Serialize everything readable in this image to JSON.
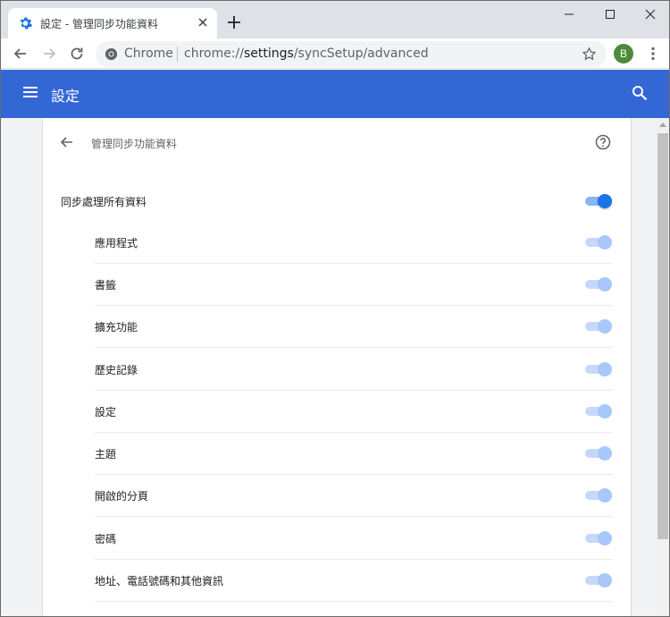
{
  "browser": {
    "tab_title": "設定 - 管理同步功能資料",
    "omnibox_scheme_label": "Chrome",
    "url_prefix": "chrome://",
    "url_host": "settings",
    "url_path": "/syncSetup/advanced",
    "profile_initial": "B",
    "profile_color": "#4e8a3a"
  },
  "header": {
    "title": "設定",
    "color": "#3367d6"
  },
  "subpage": {
    "title": "管理同步功能資料",
    "master_toggle_label": "同步處理所有資料",
    "master_toggle_on": true,
    "items": [
      {
        "label": "應用程式",
        "on": true
      },
      {
        "label": "書籤",
        "on": true
      },
      {
        "label": "擴充功能",
        "on": true
      },
      {
        "label": "歷史記錄",
        "on": true
      },
      {
        "label": "設定",
        "on": true
      },
      {
        "label": "主題",
        "on": true
      },
      {
        "label": "開啟的分頁",
        "on": true
      },
      {
        "label": "密碼",
        "on": true
      },
      {
        "label": "地址、電話號碼和其他資訊",
        "on": true
      }
    ]
  }
}
